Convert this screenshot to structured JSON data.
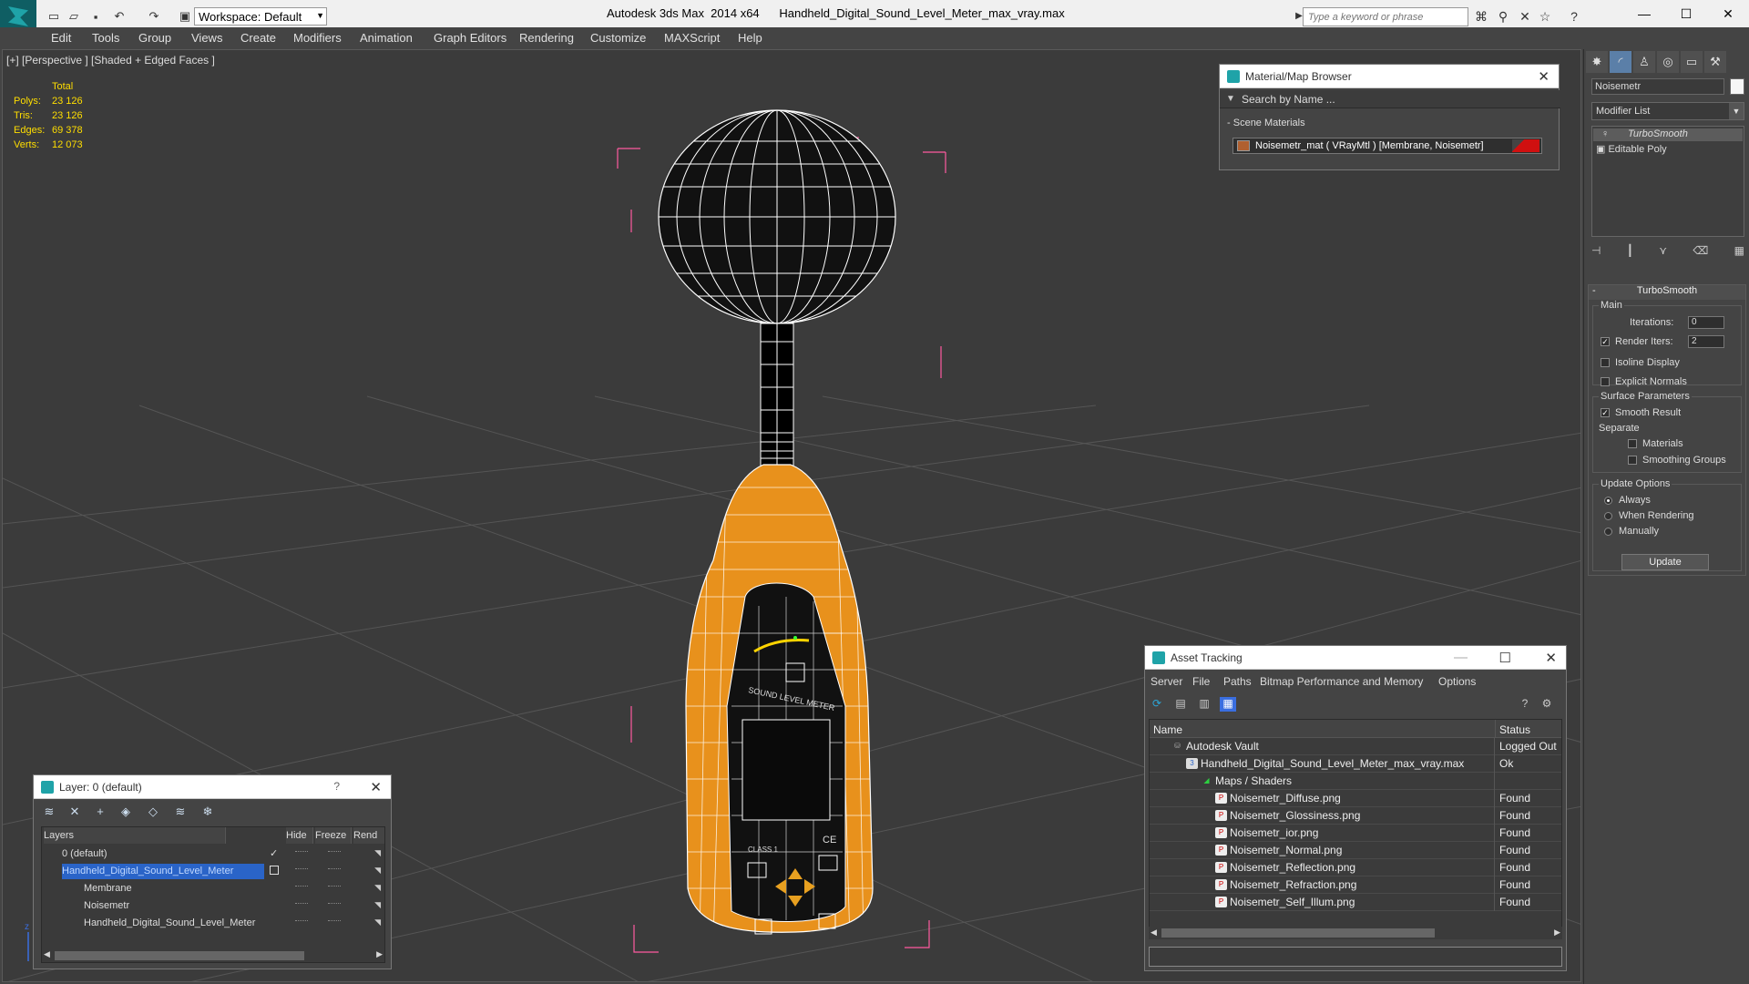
{
  "titlebar": {
    "app_title": "Autodesk 3ds Max  2014 x64",
    "file_title": "Handheld_Digital_Sound_Level_Meter_max_vray.max",
    "workspace": "Workspace: Default",
    "search_placeholder": "Type a keyword or phrase"
  },
  "menu": [
    "Edit",
    "Tools",
    "Group",
    "Views",
    "Create",
    "Modifiers",
    "Animation",
    "Graph Editors",
    "Rendering",
    "Customize",
    "MAXScript",
    "Help"
  ],
  "viewport": {
    "label": "[+] [Perspective ] [Shaded + Edged Faces ]",
    "stats": {
      "header": "Total",
      "rows": [
        {
          "k": "Polys:",
          "v": "23 126"
        },
        {
          "k": "Tris:",
          "v": "23 126"
        },
        {
          "k": "Edges:",
          "v": "69 378"
        },
        {
          "k": "Verts:",
          "v": "12 073"
        }
      ]
    },
    "colors": {
      "stats": "#ffde00",
      "bbox": "#ff5aa0",
      "device_orange": "#e8911c",
      "wire": "#ffffff"
    }
  },
  "material_browser": {
    "title": "Material/Map Browser",
    "search": "Search by Name ...",
    "section": "Scene Materials",
    "item": "Noisemetr_mat  ( VRayMtl )  [Membrane, Noisemetr]"
  },
  "command_panel": {
    "object_name": "Noisemetr",
    "modifier_list": "Modifier List",
    "stack": [
      "TurboSmooth",
      "Editable Poly"
    ],
    "rollout_title": "TurboSmooth",
    "main_group": "Main",
    "iterations_label": "Iterations:",
    "iterations_value": "0",
    "render_iters_label": "Render Iters:",
    "render_iters_value": "2",
    "isoline": "Isoline Display",
    "explicit_normals": "Explicit Normals",
    "surface_group": "Surface Parameters",
    "smooth_result": "Smooth Result",
    "separate": "Separate",
    "materials": "Materials",
    "smoothing_groups": "Smoothing Groups",
    "update_group": "Update Options",
    "always": "Always",
    "when_rendering": "When Rendering",
    "manually": "Manually",
    "update_button": "Update"
  },
  "layer_panel": {
    "title": "Layer: 0 (default)",
    "help": "?",
    "headers": {
      "layers": "Layers",
      "hide": "Hide",
      "freeze": "Freeze",
      "render": "Rend"
    },
    "rows": [
      {
        "name": "0 (default)",
        "indent": 0
      },
      {
        "name": "Handheld_Digital_Sound_Level_Meter",
        "indent": 0
      },
      {
        "name": "Membrane",
        "indent": 1
      },
      {
        "name": "Noisemetr",
        "indent": 1
      },
      {
        "name": "Handheld_Digital_Sound_Level_Meter",
        "indent": 1
      }
    ]
  },
  "asset_tracking": {
    "title": "Asset Tracking",
    "menu": [
      "Server",
      "File",
      "Paths",
      "Bitmap Performance and Memory",
      "Options"
    ],
    "headers": {
      "name": "Name",
      "status": "Status"
    },
    "rows": [
      {
        "name": "Autodesk Vault",
        "status": "Logged Out",
        "indent": 1
      },
      {
        "name": "Handheld_Digital_Sound_Level_Meter_max_vray.max",
        "status": "Ok",
        "indent": 2
      },
      {
        "name": "Maps / Shaders",
        "status": "",
        "indent": 3
      },
      {
        "name": "Noisemetr_Diffuse.png",
        "status": "Found",
        "indent": 4
      },
      {
        "name": "Noisemetr_Glossiness.png",
        "status": "Found",
        "indent": 4
      },
      {
        "name": "Noisemetr_ior.png",
        "status": "Found",
        "indent": 4
      },
      {
        "name": "Noisemetr_Normal.png",
        "status": "Found",
        "indent": 4
      },
      {
        "name": "Noisemetr_Reflection.png",
        "status": "Found",
        "indent": 4
      },
      {
        "name": "Noisemetr_Refraction.png",
        "status": "Found",
        "indent": 4
      },
      {
        "name": "Noisemetr_Self_Illum.png",
        "status": "Found",
        "indent": 4
      }
    ]
  },
  "device_labels": {
    "brand": "SOUND LEVEL METER",
    "class": "CLASS 1",
    "ce": "CE"
  }
}
